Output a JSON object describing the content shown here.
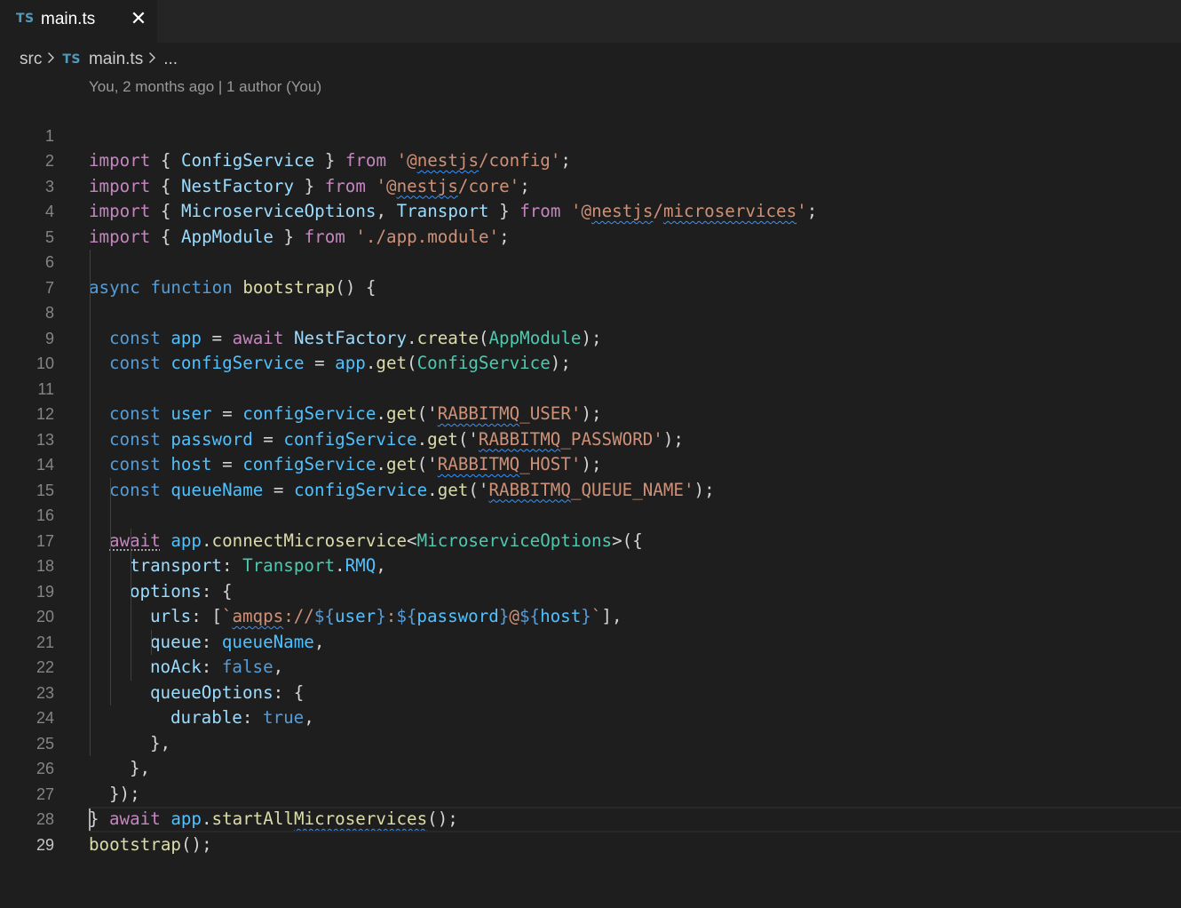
{
  "tab": {
    "badge": "TS",
    "label": "main.ts",
    "close": "✕"
  },
  "breadcrumb": {
    "folder": "src",
    "file_badge": "TS",
    "file": "main.ts",
    "more": "..."
  },
  "codelens": "You, 2 months ago | 1 author (You)",
  "line_numbers": [
    "1",
    "2",
    "3",
    "4",
    "5",
    "6",
    "7",
    "8",
    "9",
    "10",
    "11",
    "12",
    "13",
    "14",
    "15",
    "16",
    "17",
    "18",
    "19",
    "20",
    "21",
    "22",
    "23",
    "24",
    "25",
    "26",
    "27",
    "28",
    "29"
  ],
  "code": {
    "l1": [
      "import",
      " { ",
      "ConfigService",
      " } ",
      "from",
      " '@",
      "nestjs",
      "/config'",
      ";"
    ],
    "l2": [
      "import",
      " { ",
      "NestFactory",
      " } ",
      "from",
      " '@",
      "nestjs",
      "/core'",
      ";"
    ],
    "l3": [
      "import",
      " { ",
      "MicroserviceOptions",
      ", ",
      "Transport",
      " } ",
      "from",
      " '@",
      "nestjs",
      "/",
      "microservices",
      "'",
      ";"
    ],
    "l4": [
      "import",
      " { ",
      "AppModule",
      " } ",
      "from",
      " './app.module'",
      ";"
    ],
    "l6": [
      "async",
      " ",
      "function",
      " ",
      "bootstrap",
      "() {"
    ],
    "l7": [
      "const",
      " ",
      "app",
      " = ",
      "await",
      " ",
      "NestFactory",
      ".",
      "create",
      "(",
      "AppModule",
      ");"
    ],
    "l8": [
      "const",
      " ",
      "configService",
      " = ",
      "app",
      ".",
      "get",
      "(",
      "ConfigService",
      ");"
    ],
    "l10": [
      "const",
      " ",
      "user",
      " = ",
      "configService",
      ".",
      "get",
      "('",
      "RABBITMQ",
      "_USER'",
      ");"
    ],
    "l11": [
      "const",
      " ",
      "password",
      " = ",
      "configService",
      ".",
      "get",
      "('",
      "RABBITMQ",
      "_PASSWORD'",
      ");"
    ],
    "l12": [
      "const",
      " ",
      "host",
      " = ",
      "configService",
      ".",
      "get",
      "('",
      "RABBITMQ",
      "_HOST'",
      ");"
    ],
    "l13": [
      "const",
      " ",
      "queueName",
      " = ",
      "configService",
      ".",
      "get",
      "('",
      "RABBITMQ",
      "_QUEUE_NAME'",
      ");"
    ],
    "l15": [
      "await",
      " ",
      "app",
      ".",
      "connectMicroservice",
      "<",
      "MicroserviceOptions",
      ">({"
    ],
    "l16": [
      "transport",
      ": ",
      "Transport",
      ".",
      "RMQ",
      ","
    ],
    "l17": [
      "options",
      ": {"
    ],
    "l18": [
      "urls",
      ": [",
      "`",
      "amqps",
      "://",
      "${",
      "user",
      "}",
      ":",
      "${",
      "password",
      "}",
      "@",
      "${",
      "host",
      "}",
      "`",
      "],"
    ],
    "l19": [
      "queue",
      ": ",
      "queueName",
      ","
    ],
    "l20": [
      "noAck",
      ": ",
      "false",
      ","
    ],
    "l21": [
      "queueOptions",
      ": {"
    ],
    "l22": [
      "durable",
      ": ",
      "true",
      ","
    ],
    "l23": [
      "},"
    ],
    "l24": [
      "},"
    ],
    "l25": [
      "});"
    ],
    "l26": [
      "await",
      " ",
      "app",
      ".",
      "startAll",
      "Microservices",
      "();"
    ],
    "l27": [
      "}"
    ],
    "l28": [
      "bootstrap",
      "();"
    ]
  },
  "colors": {
    "background": "#1e1e1e",
    "tabbar": "#252526",
    "keyword": "#569cd6",
    "control": "#c586c0",
    "string": "#ce9178",
    "variable": "#9cdcfe",
    "function": "#dcdcaa",
    "type": "#4ec9b0",
    "constant": "#4fc1ff",
    "squiggle": "#3794ff"
  }
}
